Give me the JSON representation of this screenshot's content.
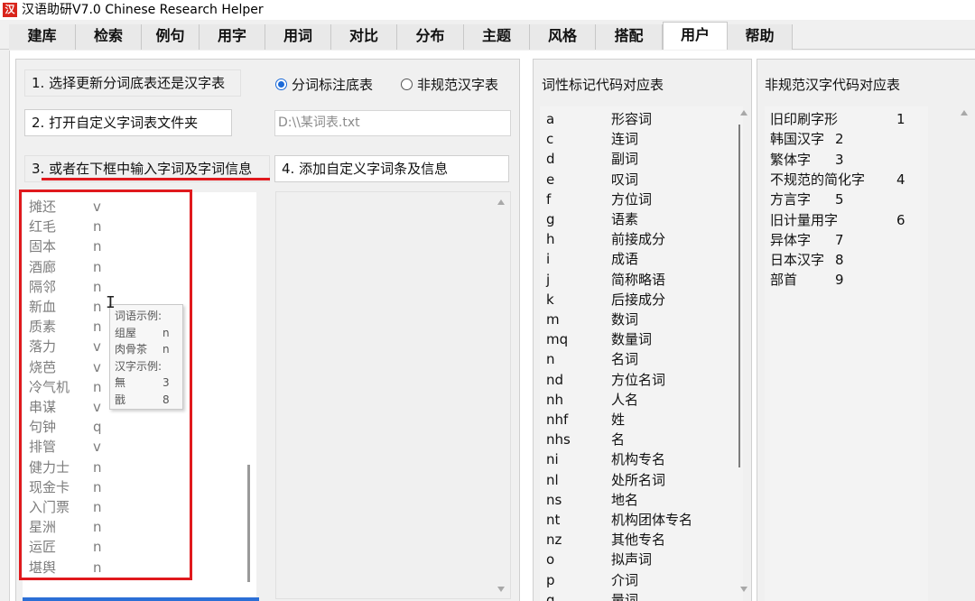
{
  "window": {
    "icon_glyph": "汉",
    "title": "汉语助研V7.0  Chinese Research Helper"
  },
  "tabs": [
    {
      "label": "建库"
    },
    {
      "label": "检索"
    },
    {
      "label": "例句"
    },
    {
      "label": "用字"
    },
    {
      "label": "用词"
    },
    {
      "label": "对比"
    },
    {
      "label": "分布"
    },
    {
      "label": "主题"
    },
    {
      "label": "风格"
    },
    {
      "label": "搭配"
    },
    {
      "label": "用户",
      "active": true
    },
    {
      "label": "帮助"
    }
  ],
  "steps": {
    "step1": "1. 选择更新分词底表还是汉字表",
    "step2": "2. 打开自定义字词表文件夹",
    "step3": "3. 或者在下框中输入字词及字词信息",
    "step4": "4. 添加自定义字词条及信息"
  },
  "radio": {
    "option1": "分词标注底表",
    "option1_selected": true,
    "option2": "非规范汉字表",
    "option2_selected": false
  },
  "path_input": {
    "value": "D:\\\\某词表.txt"
  },
  "word_list": [
    {
      "word": "摊还",
      "pos": "v"
    },
    {
      "word": "红毛",
      "pos": "n"
    },
    {
      "word": "固本",
      "pos": "n"
    },
    {
      "word": "酒廊",
      "pos": "n"
    },
    {
      "word": "隔邻",
      "pos": "n"
    },
    {
      "word": "新血",
      "pos": "n"
    },
    {
      "word": "质素",
      "pos": "n"
    },
    {
      "word": "落力",
      "pos": "v"
    },
    {
      "word": "烧芭",
      "pos": "v"
    },
    {
      "word": "冷气机",
      "pos": "n"
    },
    {
      "word": "串谋",
      "pos": "v"
    },
    {
      "word": "句钟",
      "pos": "q"
    },
    {
      "word": "排管",
      "pos": "v"
    },
    {
      "word": "健力士",
      "pos": "n"
    },
    {
      "word": "现金卡",
      "pos": "n"
    },
    {
      "word": "入门票",
      "pos": "n"
    },
    {
      "word": "星洲",
      "pos": "n"
    },
    {
      "word": "运匠",
      "pos": "n"
    },
    {
      "word": "堪舆",
      "pos": "n"
    }
  ],
  "tooltip": {
    "rows": [
      {
        "label": "词语示例:",
        "value": ""
      },
      {
        "label": "组屋",
        "value": "n"
      },
      {
        "label": "肉骨茶",
        "value": "n"
      },
      {
        "label": "汉字示例:",
        "value": ""
      },
      {
        "label": "無",
        "value": "3"
      },
      {
        "label": "戩",
        "value": "8"
      }
    ]
  },
  "pos_table": {
    "title": "词性标记代码对应表",
    "rows": [
      {
        "code": "a",
        "name": "形容词"
      },
      {
        "code": "c",
        "name": "连词"
      },
      {
        "code": "d",
        "name": "副词"
      },
      {
        "code": "e",
        "name": "叹词"
      },
      {
        "code": "f",
        "name": "方位词"
      },
      {
        "code": "g",
        "name": "语素"
      },
      {
        "code": "h",
        "name": "前接成分"
      },
      {
        "code": "i",
        "name": "成语"
      },
      {
        "code": "j",
        "name": "简称略语"
      },
      {
        "code": "k",
        "name": "后接成分"
      },
      {
        "code": "m",
        "name": "数词"
      },
      {
        "code": "mq",
        "name": "数量词"
      },
      {
        "code": "n",
        "name": "名词"
      },
      {
        "code": "nd",
        "name": "方位名词"
      },
      {
        "code": "nh",
        "name": "人名"
      },
      {
        "code": "nhf",
        "name": "姓"
      },
      {
        "code": "nhs",
        "name": "名"
      },
      {
        "code": "ni",
        "name": "机构专名"
      },
      {
        "code": "nl",
        "name": "处所名词"
      },
      {
        "code": "ns",
        "name": "地名"
      },
      {
        "code": "nt",
        "name": "机构团体专名"
      },
      {
        "code": "nz",
        "name": "其他专名"
      },
      {
        "code": "o",
        "name": "拟声词"
      },
      {
        "code": "p",
        "name": "介词"
      },
      {
        "code": "q",
        "name": "量词"
      }
    ]
  },
  "variant_table": {
    "title": "非规范汉字代码对应表",
    "rows": [
      {
        "name": "旧印刷字形",
        "code": "1"
      },
      {
        "name": "韩国汉字",
        "code": "2"
      },
      {
        "name": "繁体字",
        "code": "3"
      },
      {
        "name": "不规范的简化字",
        "code": "4"
      },
      {
        "name": "方言字",
        "code": "5"
      },
      {
        "name": "旧计量用字",
        "code": "6"
      },
      {
        "name": "异体字",
        "code": "7"
      },
      {
        "name": "日本汉字",
        "code": "8"
      },
      {
        "name": "部首",
        "code": "9"
      }
    ]
  },
  "colors": {
    "highlight_red": "#e0191d",
    "accent_blue": "#1b6ad8"
  }
}
